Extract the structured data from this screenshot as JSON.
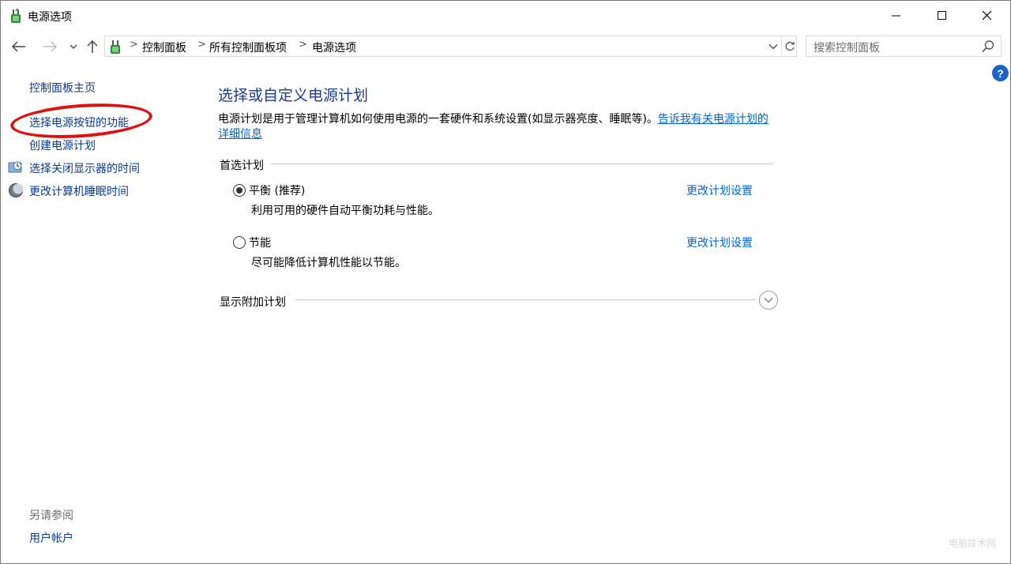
{
  "window": {
    "title": "电源选项",
    "icons": {
      "app": "power-options-icon",
      "minimize": "minimize-icon",
      "maximize": "maximize-icon",
      "close": "close-icon"
    }
  },
  "navigation": {
    "icons": {
      "back": "arrow-left-icon",
      "forward": "arrow-right-icon",
      "recent": "chevron-down-icon",
      "up": "arrow-up-icon"
    }
  },
  "address_bar": {
    "breadcrumbs": [
      "控制面板",
      "所有控制面板项",
      "电源选项"
    ],
    "separator": ">",
    "icons": {
      "location": "power-options-icon",
      "dropdown": "chevron-down-icon",
      "refresh": "refresh-icon"
    }
  },
  "search": {
    "placeholder": "搜索控制面板",
    "icon": "search-icon"
  },
  "help": {
    "label": "?"
  },
  "left_pane": {
    "home": "控制面板主页",
    "links": [
      {
        "label": "选择电源按钮的功能",
        "icon": null
      },
      {
        "label": "创建电源计划",
        "icon": null
      },
      {
        "label": "选择关闭显示器的时间",
        "icon": "display-clock-icon"
      },
      {
        "label": "更改计算机睡眠时间",
        "icon": "moon-sleep-icon"
      }
    ],
    "see_also_title": "另请参阅",
    "see_also": [
      "用户帐户"
    ],
    "annotation_color": "#e01010"
  },
  "main": {
    "title": "选择或自定义电源计划",
    "description": "电源计划是用于管理计算机如何使用电源的一套硬件和系统设置(如显示器亮度、睡眠等)。",
    "description_link": "告诉我有关电源计划的详细信息",
    "preferred_plans_label": "首选计划",
    "plans": [
      {
        "name": "平衡 (推荐)",
        "description": "利用可用的硬件自动平衡功耗与性能。",
        "selected": true,
        "link": "更改计划设置"
      },
      {
        "name": "节能",
        "description": "尽可能降低计算机性能以节能。",
        "selected": false,
        "link": "更改计划设置"
      }
    ],
    "show_additional_label": "显示附加计划",
    "expand_icon": "chevron-down-circle-icon"
  },
  "watermark": "电脑技术网",
  "colors": {
    "link": "#0066cc",
    "heading": "#1e3c8c",
    "nav_link": "#0b3b8c",
    "help": "#1d64c8"
  }
}
